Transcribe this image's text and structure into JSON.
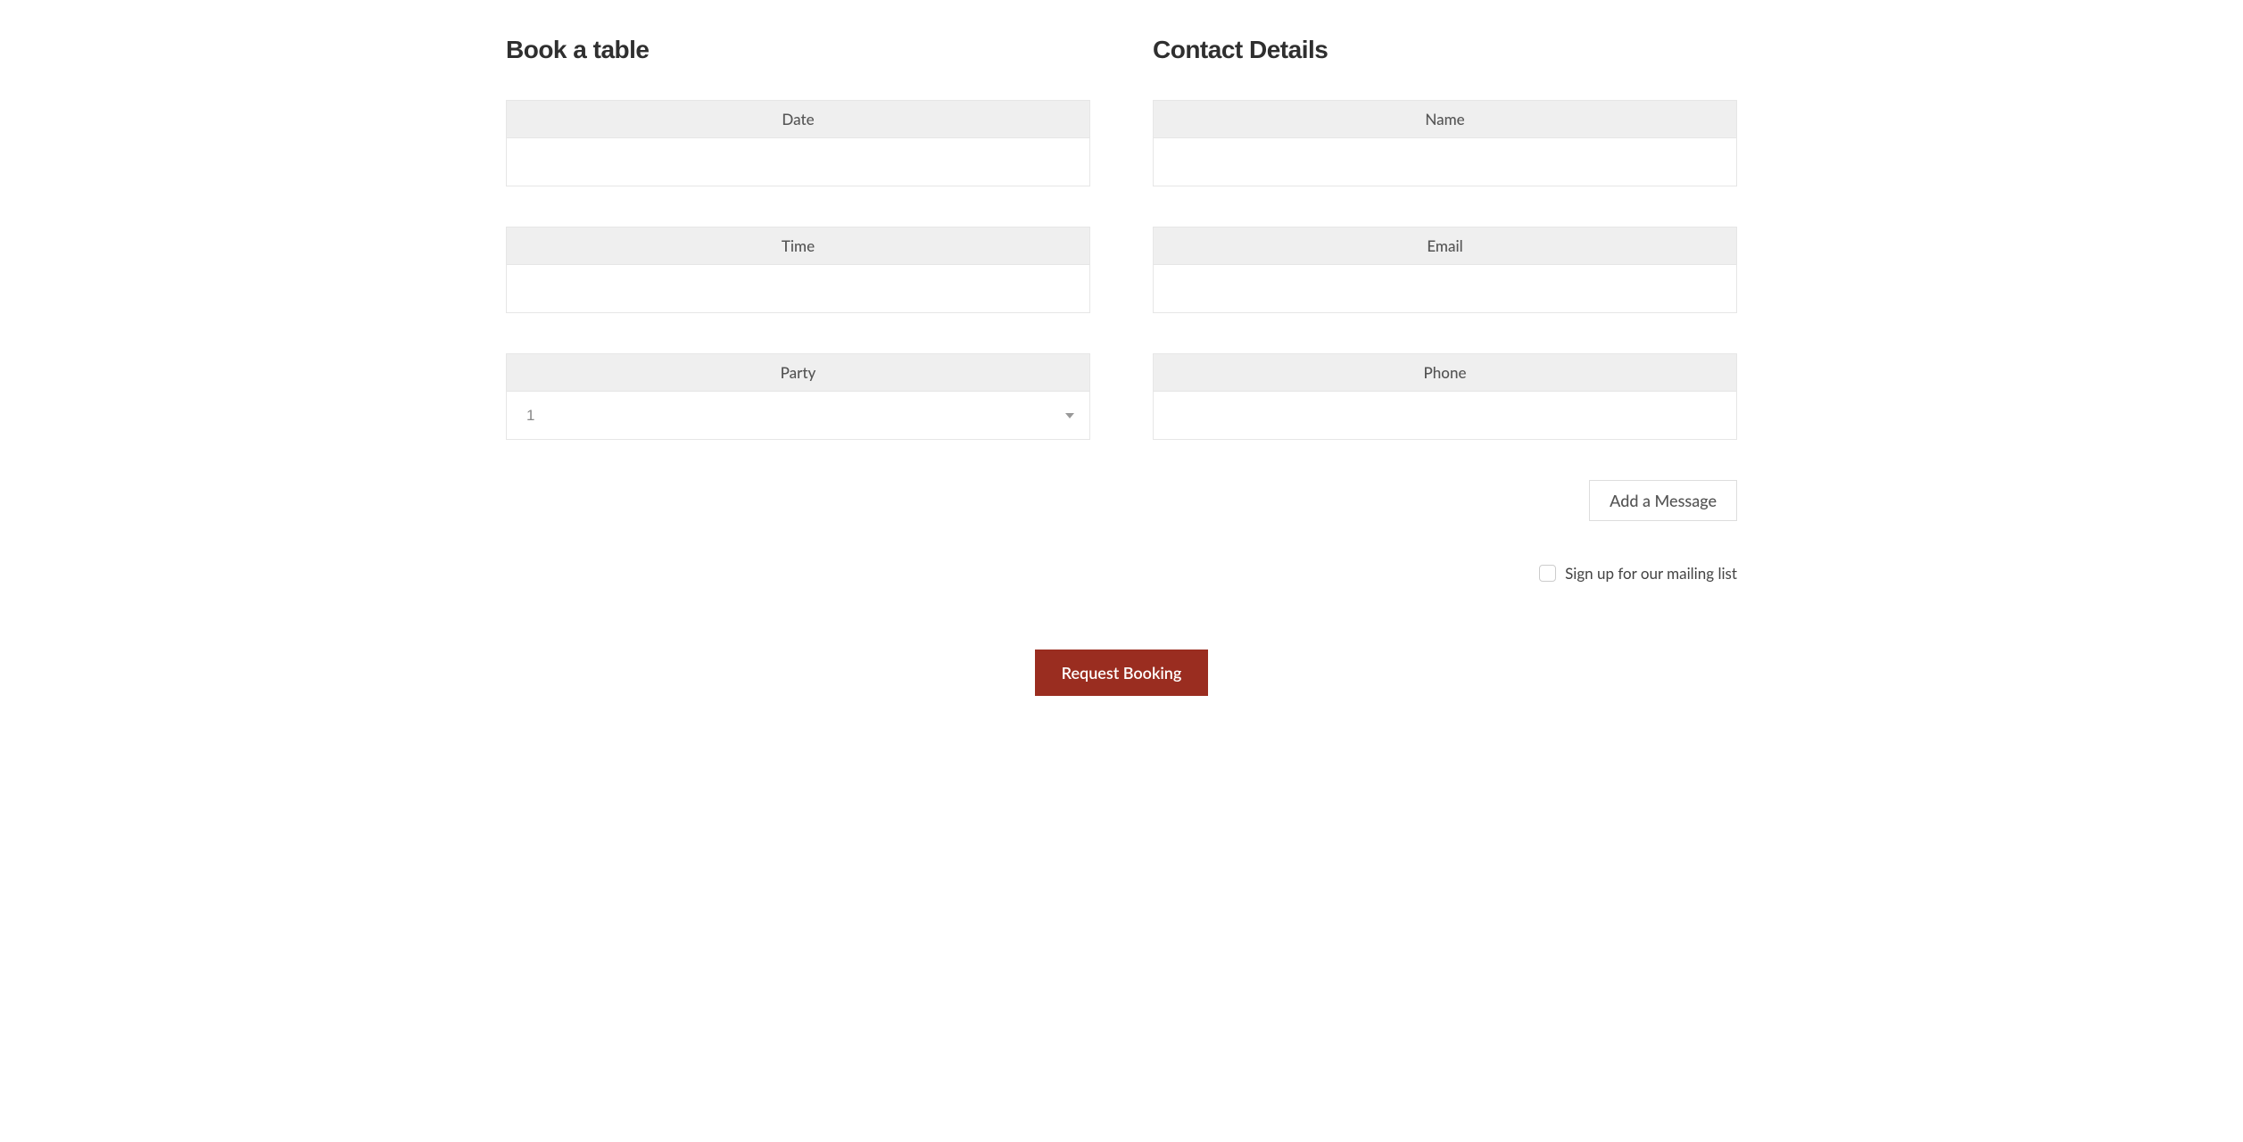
{
  "book": {
    "title": "Book a table",
    "date_label": "Date",
    "date_value": "",
    "time_label": "Time",
    "time_value": "",
    "party_label": "Party",
    "party_value": "1"
  },
  "contact": {
    "title": "Contact Details",
    "name_label": "Name",
    "name_value": "",
    "email_label": "Email",
    "email_value": "",
    "phone_label": "Phone",
    "phone_value": ""
  },
  "actions": {
    "add_message_label": "Add a Message",
    "mailing_label": "Sign up for our mailing list",
    "mailing_checked": false,
    "submit_label": "Request Booking"
  }
}
